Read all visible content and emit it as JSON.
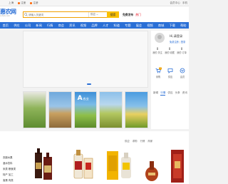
{
  "topbar": {
    "left_links": [
      "上海",
      "注册",
      "注册"
    ],
    "right_links": [
      "会员中心",
      "手机"
    ]
  },
  "header": {
    "logo_main": "惠农网",
    "logo_sub": "cnhnb.com",
    "search_placeholder": "请输入关键词",
    "search_category": "供应",
    "search_button": "搜索",
    "link_publish": "免费发布",
    "link_hot": "热门"
  },
  "nav": {
    "items": [
      "首页",
      "供应",
      "公司",
      "新闻",
      "行情",
      "商会",
      "资讯",
      "视频",
      "品牌",
      "人才",
      "知道",
      "专题",
      "展会",
      "视频",
      "商城",
      "下载",
      "帮助"
    ]
  },
  "banner": {
    "active_dot": 1
  },
  "user_panel": {
    "welcome": "Hi,请登录",
    "login_link": "免费注册",
    "separator": "|",
    "login_link2": "登录",
    "stats": [
      {
        "num": "0",
        "label": "我的 关注"
      },
      {
        "num": "0",
        "label": "我的 收藏"
      },
      {
        "num": "0",
        "label": "我的 订单"
      }
    ],
    "shortcuts": [
      {
        "label": "采购",
        "badge": "0"
      },
      {
        "label": "供应",
        "badge": ""
      },
      {
        "label": "会员",
        "badge": ""
      }
    ]
  },
  "thumbs": {
    "t3_title": "A",
    "t3_sub": "农业"
  },
  "news": {
    "tabs": [
      "新闻",
      "行情",
      "供应",
      "头条",
      "资讯"
    ],
    "active": 1
  },
  "bottom": {
    "tabs": [
      "供应",
      "求购",
      "行情",
      "商家"
    ],
    "side_items": [
      "农副水果",
      "酒水饮料",
      "米类 粮食类",
      "特产 加工",
      "禽蛋 肉类"
    ]
  }
}
